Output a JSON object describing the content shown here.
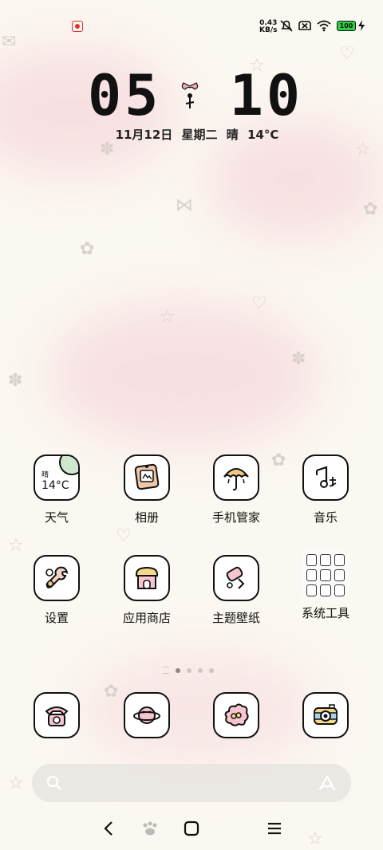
{
  "status": {
    "net_speed_value": "0.43",
    "net_speed_unit": "KB/s",
    "battery_level": "100"
  },
  "clock": {
    "hour": "05",
    "minute": "10"
  },
  "date": {
    "day": "11月12日",
    "weekday": "星期二",
    "weather": "晴",
    "temperature": "14°C"
  },
  "apps": {
    "weather": {
      "label": "天气",
      "widget_condition": "晴",
      "widget_temp": "14°C"
    },
    "gallery": {
      "label": "相册"
    },
    "security": {
      "label": "手机管家"
    },
    "music": {
      "label": "音乐"
    },
    "settings": {
      "label": "设置"
    },
    "appstore": {
      "label": "应用商店"
    },
    "themes": {
      "label": "主题壁纸"
    },
    "tools_folder": {
      "label": "系统工具"
    }
  },
  "dock": {
    "items": [
      "phone-icon",
      "messages-icon",
      "browser-icon",
      "camera-icon"
    ]
  },
  "pages": {
    "count": 4,
    "current": 1
  },
  "colors": {
    "background": "#fbf7f1",
    "blush": "#f6d9dd",
    "battery_green": "#2bd23f"
  }
}
